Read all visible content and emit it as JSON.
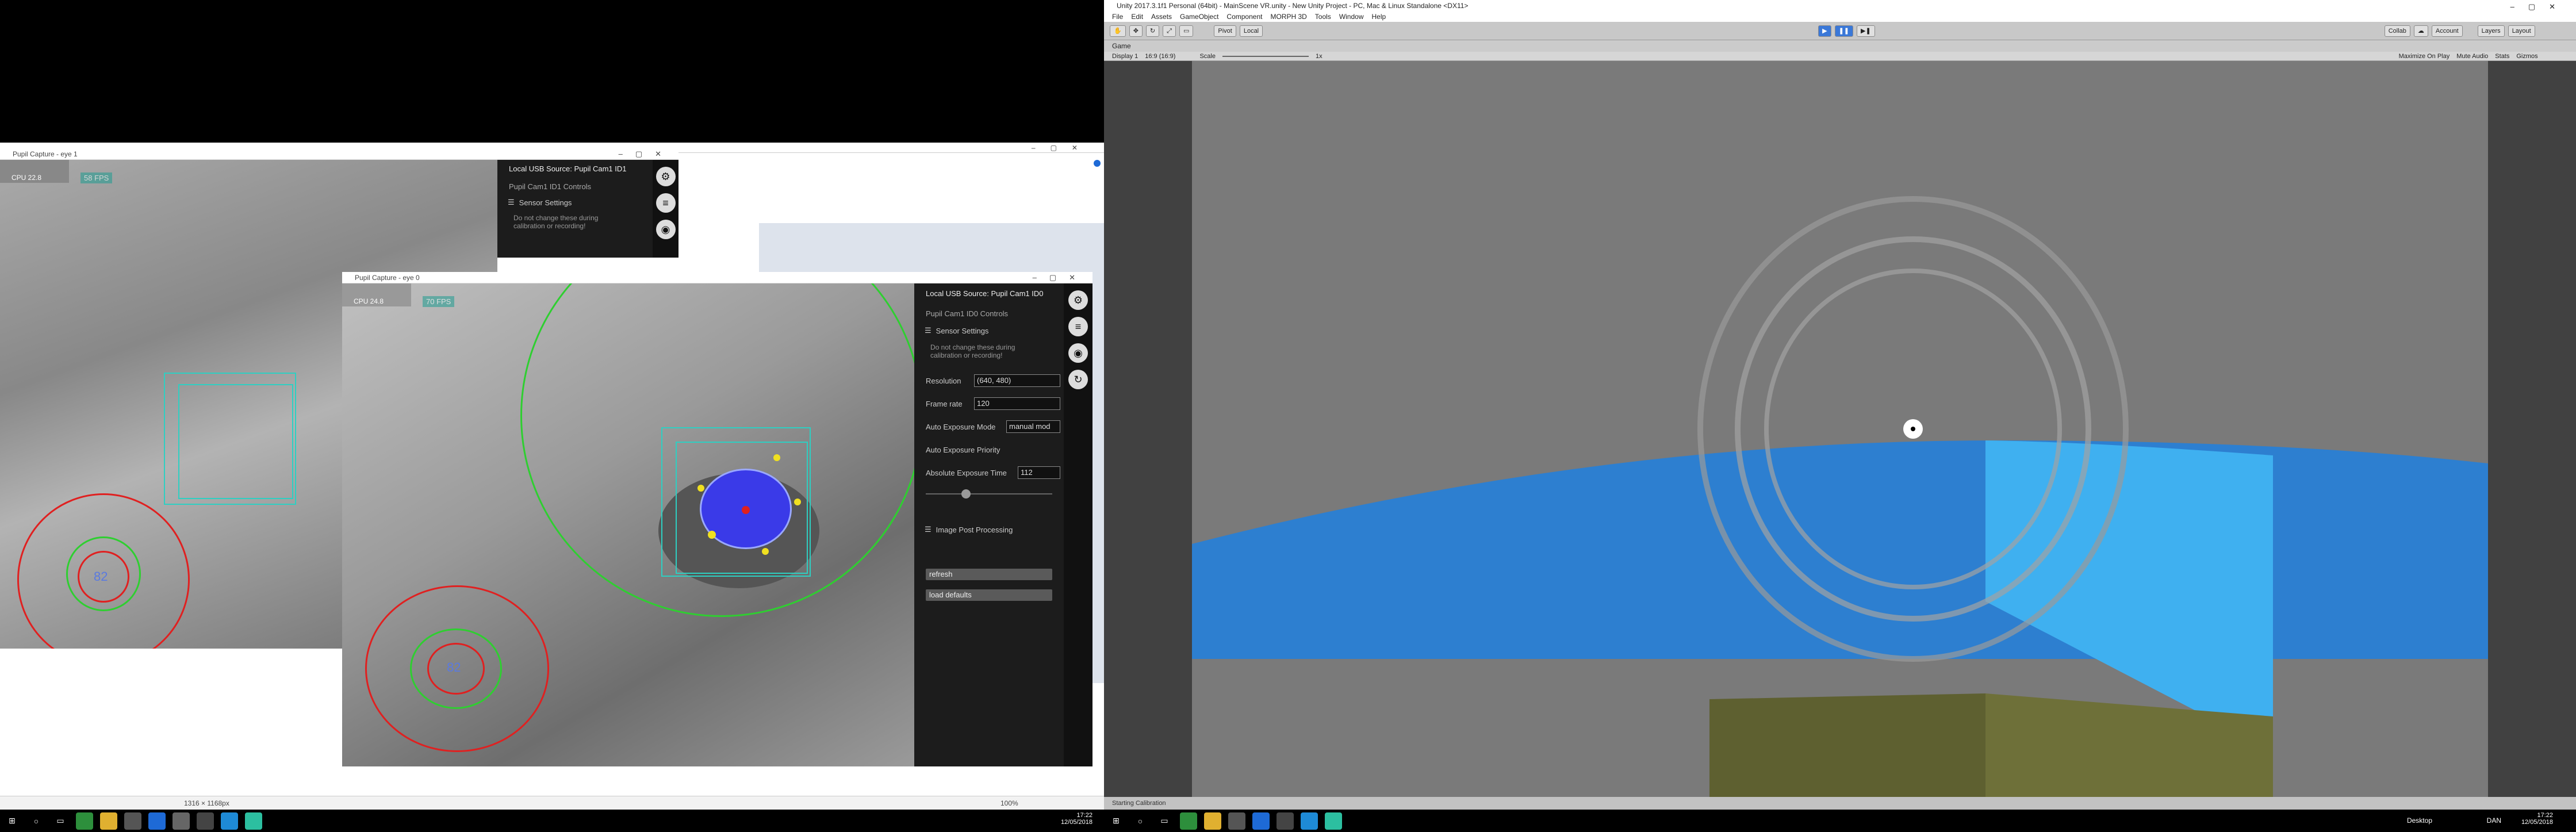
{
  "left_monitor": {
    "bg_window": {
      "title_fragment": "..."
    },
    "eye1": {
      "title": "Pupil Capture - eye 1",
      "fps": "58 FPS",
      "cpu": "CPU 22.8",
      "circle_label": "82",
      "sidebar": {
        "source": "Local USB Source: Pupil Cam1 ID1",
        "controls": "Pupil Cam1 ID1 Controls",
        "sensor_settings": "Sensor Settings",
        "note": "Do not change these during calibration or recording!"
      }
    },
    "eye0": {
      "title": "Pupil Capture - eye 0",
      "fps": "70 FPS",
      "cpu": "CPU 24.8",
      "circle_label": "82",
      "sidebar": {
        "source": "Local USB Source: Pupil Cam1 ID0",
        "controls": "Pupil Cam1 ID0 Controls",
        "sensor_settings": "Sensor Settings",
        "note": "Do not change these during calibration or recording!",
        "resolution_label": "Resolution",
        "resolution_value": "(640, 480)",
        "framerate_label": "Frame rate",
        "framerate_value": "120",
        "auto_exposure_mode_label": "Auto Exposure Mode",
        "auto_exposure_mode_value": "manual mod",
        "auto_exposure_priority_label": "Auto Exposure Priority",
        "abs_exposure_label": "Absolute Exposure Time",
        "abs_exposure_value": "112",
        "image_post": "Image Post Processing",
        "refresh": "refresh",
        "load_defaults": "load defaults"
      }
    },
    "statusbar": {
      "size": "1316 × 1168px",
      "zoom": "100%"
    },
    "taskbar": {
      "time": "17:22",
      "date": "12/05/2018"
    }
  },
  "unity": {
    "title": "Unity 2017.3.1f1 Personal (64bit) - MainScene VR.unity - New Unity Project - PC, Mac & Linux Standalone <DX11>",
    "menu": [
      "File",
      "Edit",
      "Assets",
      "GameObject",
      "Component",
      "MORPH 3D",
      "Tools",
      "Window",
      "Help"
    ],
    "toolbar": {
      "pivot": "Pivot",
      "local": "Local",
      "collab": "Collab",
      "account": "Account",
      "layers": "Layers",
      "layout": "Layout"
    },
    "game_tab": "Game",
    "gamebar": {
      "display": "Display 1",
      "aspect": "16:9 (16:9)",
      "scale": "Scale",
      "scale_val": "1x",
      "maximize": "Maximize On Play",
      "mute": "Mute Audio",
      "stats": "Stats",
      "gizmos": "Gizmos"
    },
    "status": "Starting Calibration",
    "taskbar": {
      "desktop": "Desktop",
      "lang": "DAN",
      "time": "17:22",
      "date": "12/05/2018"
    }
  }
}
